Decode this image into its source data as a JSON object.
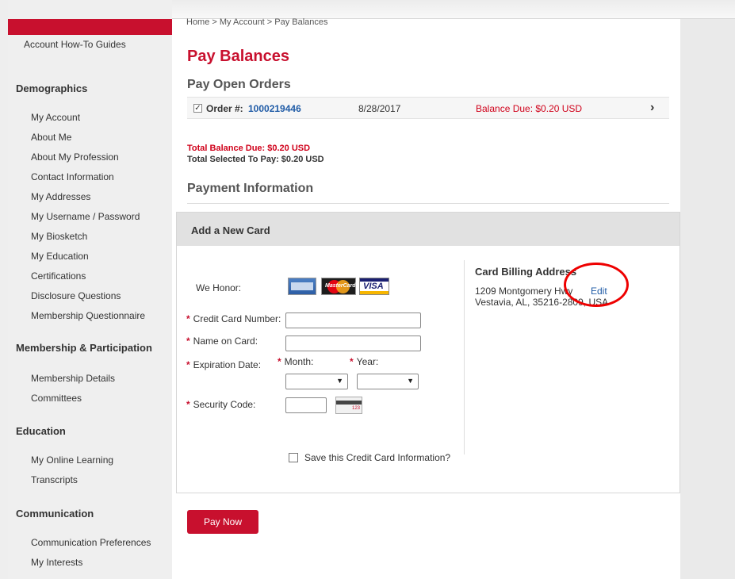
{
  "sidebar": {
    "top_item": "Account How-To Guides",
    "sections": [
      {
        "title": "Demographics",
        "items": [
          "My Account",
          "About Me",
          "About My Profession",
          "Contact Information",
          "My Addresses",
          "My Username / Password",
          "My Biosketch",
          "My Education",
          "Certifications",
          "Disclosure Questions",
          "Membership Questionnaire"
        ]
      },
      {
        "title": "Membership & Participation",
        "items": [
          "Membership Details",
          "Committees"
        ]
      },
      {
        "title": "Education",
        "items": [
          "My Online Learning",
          "Transcripts"
        ]
      },
      {
        "title": "Communication",
        "items": [
          "Communication Preferences",
          "My Interests"
        ]
      }
    ]
  },
  "main": {
    "breadcrumb": "Home > My Account > Pay Balances",
    "title": "Pay Balances",
    "open_orders_title": "Pay Open Orders",
    "order": {
      "label": "Order #:",
      "number": "1000219446",
      "date": "8/28/2017",
      "balance": "Balance Due: $0.20 USD"
    },
    "total_due": "Total Balance Due: $0.20 USD",
    "total_selected": "Total Selected To Pay: $0.20 USD",
    "payment_info_title": "Payment Information",
    "card": {
      "header": "Add a New Card",
      "we_honor": "We Honor:",
      "card_number_label": "Credit Card Number:",
      "name_label": "Name on Card:",
      "expiration_label": "Expiration Date:",
      "month_label": "Month:",
      "year_label": "Year:",
      "security_label": "Security Code:",
      "save_label": "Save this Credit Card Information?",
      "required_mark": "*",
      "logos": {
        "mastercard_text": "MasterCard",
        "visa_text": "VISA",
        "cvv_text": "123"
      }
    },
    "billing": {
      "title": "Card Billing Address",
      "line1": "1209 Montgomery Hwy",
      "line2": "Vestavia, AL, 35216-2809, USA",
      "edit": "Edit"
    },
    "pay_button": "Pay Now"
  },
  "colors": {
    "brand_red": "#c8102e",
    "link_blue": "#1f5ba6",
    "alert_red": "#d0021b"
  }
}
